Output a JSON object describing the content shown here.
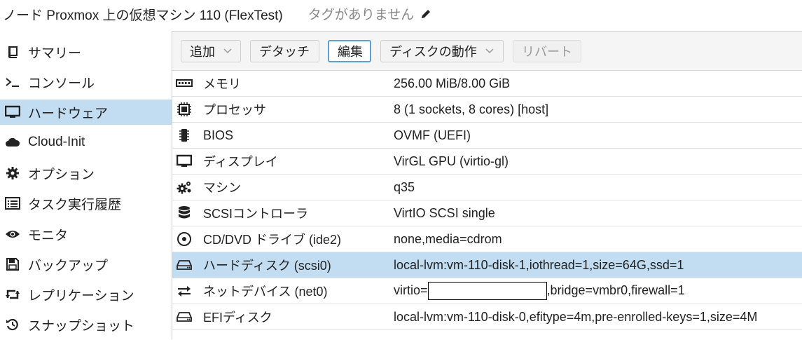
{
  "header": {
    "title": "ノード Proxmox 上の仮想マシン 110 (FlexTest)",
    "tags_placeholder": "タグがありません"
  },
  "sidebar": {
    "items": [
      {
        "label": "サマリー",
        "icon": "book-icon"
      },
      {
        "label": "コンソール",
        "icon": "terminal-icon"
      },
      {
        "label": "ハードウェア",
        "icon": "monitor-icon",
        "active": true
      },
      {
        "label": "Cloud-Init",
        "icon": "cloud-icon"
      },
      {
        "label": "オプション",
        "icon": "gear-icon"
      },
      {
        "label": "タスク実行履歴",
        "icon": "list-icon"
      },
      {
        "label": "モニタ",
        "icon": "eye-icon"
      },
      {
        "label": "バックアップ",
        "icon": "floppy-icon"
      },
      {
        "label": "レプリケーション",
        "icon": "retweet-icon"
      },
      {
        "label": "スナップショット",
        "icon": "history-icon"
      }
    ]
  },
  "toolbar": {
    "add": "追加",
    "detach": "デタッチ",
    "edit": "編集",
    "disk_action": "ディスクの動作",
    "revert": "リバート"
  },
  "hardware": {
    "rows": [
      {
        "name": "メモリ",
        "value": "256.00 MiB/8.00 GiB",
        "icon": "memory-icon"
      },
      {
        "name": "プロセッサ",
        "value": "8 (1 sockets, 8 cores) [host]",
        "icon": "cpu-icon"
      },
      {
        "name": "BIOS",
        "value": "OVMF (UEFI)",
        "icon": "microchip-icon"
      },
      {
        "name": "ディスプレイ",
        "value": "VirGL GPU (virtio-gl)",
        "icon": "display-icon"
      },
      {
        "name": "マシン",
        "value": "q35",
        "icon": "cogs-icon"
      },
      {
        "name": "SCSIコントローラ",
        "value": "VirtIO SCSI single",
        "icon": "database-icon"
      },
      {
        "name": "CD/DVD ドライブ (ide2)",
        "value": "none,media=cdrom",
        "icon": "cdrom-icon"
      },
      {
        "name": "ハードディスク (scsi0)",
        "value": "local-lvm:vm-110-disk-1,iothread=1,size=64G,ssd=1",
        "icon": "hdd-icon",
        "selected": true
      },
      {
        "name": "ネットデバイス (net0)",
        "value_prefix": "virtio=",
        "value_suffix": ",bridge=vmbr0,firewall=1",
        "icon": "exchange-icon"
      },
      {
        "name": "EFIディスク",
        "value": "local-lvm:vm-110-disk-0,efitype=4m,pre-enrolled-keys=1,size=4M",
        "icon": "hdd-icon"
      }
    ]
  },
  "colors": {
    "selected_bg": "#c2ddf2",
    "focus_border": "#5aa1d9"
  }
}
